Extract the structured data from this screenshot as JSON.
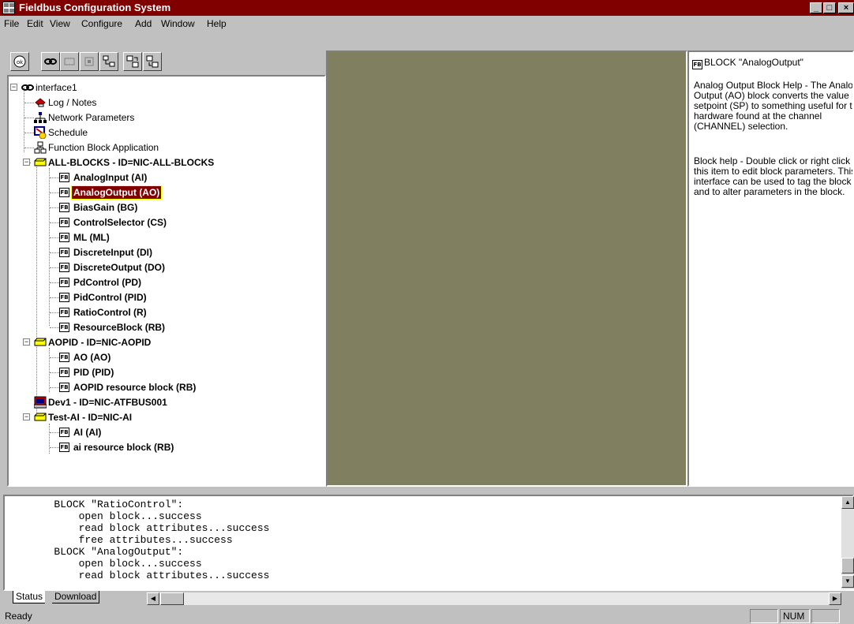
{
  "window": {
    "title": "Fieldbus Configuration System",
    "min_glyph": "_",
    "max_glyph": "□",
    "close_glyph": "×"
  },
  "menu": [
    "File",
    "Edit",
    "View",
    "Configure",
    "Add",
    "Window",
    "Help"
  ],
  "toolbar": {
    "buttons": [
      "ok-button",
      "link-button",
      "disabled-button-1",
      "disabled-button-2",
      "function-block-app-button",
      "download-button",
      "upload-button"
    ]
  },
  "tree": {
    "root": "interface1",
    "top_items": [
      "Log / Notes",
      "Network Parameters",
      "Schedule",
      "Function Block Application"
    ],
    "devices": [
      {
        "label": "ALL-BLOCKS - ID=NIC-ALL-BLOCKS",
        "blocks": [
          "AnalogInput (AI)",
          "AnalogOutput (AO)",
          "BiasGain (BG)",
          "ControlSelector (CS)",
          "ML (ML)",
          "DiscreteInput (DI)",
          "DiscreteOutput (DO)",
          "PdControl (PD)",
          "PidControl (PID)",
          "RatioControl (R)",
          "ResourceBlock (RB)"
        ]
      },
      {
        "label": "AOPID - ID=NIC-AOPID",
        "blocks": [
          "AO (AO)",
          "PID (PID)",
          "AOPID resource block (RB)"
        ]
      },
      {
        "label": "Dev1 - ID=NIC-ATFBUS001",
        "blocks": []
      },
      {
        "label": "Test-AI - ID=NIC-AI",
        "blocks": [
          "AI (AI)",
          "ai resource block (RB)"
        ]
      }
    ],
    "selected": "AnalogOutput (AO)",
    "fb_icon_text": "FB"
  },
  "help": {
    "header": "BLOCK \"AnalogOutput\"",
    "paragraph1": "Analog Output Block Help - The Analog Output (AO) block converts the value in setpoint (SP) to something useful for the hardware found at the channel (CHANNEL) selection.",
    "paragraph2": "Block help - Double click or right click on this item to edit block parameters.  This interface can be used to tag the block and to alter parameters in the block."
  },
  "log": {
    "lines": [
      "        BLOCK \"RatioControl\":",
      "            open block...success",
      "            read block attributes...success",
      "            free attributes...success",
      "        BLOCK \"AnalogOutput\":",
      "            open block...success",
      "            read block attributes...success"
    ]
  },
  "tabs": [
    "Status",
    "Download"
  ],
  "status": {
    "text": "Ready",
    "num": "NUM"
  }
}
